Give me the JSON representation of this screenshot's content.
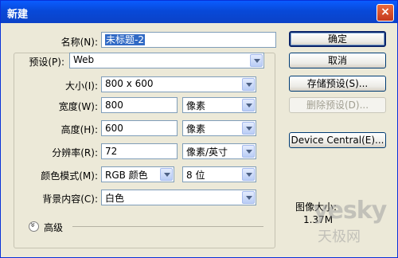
{
  "window": {
    "title": "新建",
    "close_label": "×"
  },
  "form": {
    "name_label": "名称(N):",
    "name_value": "未标题-2",
    "preset_label": "预设(P):",
    "preset_value": "Web",
    "size_label": "大小(I):",
    "size_value": "800 x 600",
    "width_label": "宽度(W):",
    "width_value": "800",
    "width_unit": "像素",
    "height_label": "高度(H):",
    "height_value": "600",
    "height_unit": "像素",
    "resolution_label": "分辨率(R):",
    "resolution_value": "72",
    "resolution_unit": "像素/英寸",
    "color_mode_label": "颜色模式(M):",
    "color_mode_value": "RGB 颜色",
    "bit_depth_value": "8 位",
    "background_label": "背景内容(C):",
    "background_value": "白色",
    "advanced_label": "高级"
  },
  "buttons": {
    "ok": "确定",
    "cancel": "取消",
    "save_preset": "存储预设(S)...",
    "delete_preset": "删除预设(D)...",
    "device_central": "Device Central(E)..."
  },
  "info": {
    "image_size_label": "图像大小:",
    "image_size_value": "1.37M"
  },
  "watermark": {
    "line1": "yesky",
    "line2": "天极网"
  }
}
